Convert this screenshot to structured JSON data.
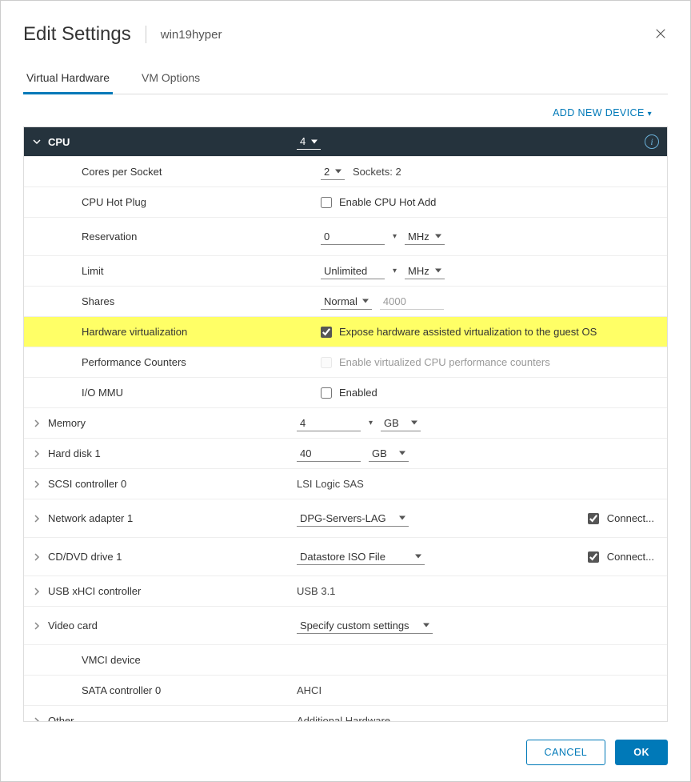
{
  "header": {
    "title": "Edit Settings",
    "subtitle": "win19hyper"
  },
  "tabs": {
    "hardware": "Virtual Hardware",
    "options": "VM Options"
  },
  "add_device": "ADD NEW DEVICE",
  "cpu": {
    "label": "CPU",
    "value": "4",
    "cores_label": "Cores per Socket",
    "cores_value": "2",
    "sockets_text": "Sockets: 2",
    "hotplug_label": "CPU Hot Plug",
    "hotplug_text": "Enable CPU Hot Add",
    "hotplug_checked": false,
    "reservation_label": "Reservation",
    "reservation_value": "0",
    "reservation_unit": "MHz",
    "limit_label": "Limit",
    "limit_value": "Unlimited",
    "limit_unit": "MHz",
    "shares_label": "Shares",
    "shares_level": "Normal",
    "shares_value": "4000",
    "hwvirt_label": "Hardware virtualization",
    "hwvirt_text": "Expose hardware assisted virtualization to the guest OS",
    "hwvirt_checked": true,
    "perf_label": "Performance Counters",
    "perf_text": "Enable virtualized CPU performance counters",
    "perf_checked": false,
    "perf_disabled": true,
    "iommu_label": "I/O MMU",
    "iommu_text": "Enabled",
    "iommu_checked": false
  },
  "memory": {
    "label": "Memory",
    "value": "4",
    "unit": "GB"
  },
  "disk": {
    "label": "Hard disk 1",
    "value": "40",
    "unit": "GB"
  },
  "scsi": {
    "label": "SCSI controller 0",
    "value": "LSI Logic SAS"
  },
  "net": {
    "label": "Network adapter 1",
    "value": "DPG-Servers-LAG",
    "connect": "Connect...",
    "connected": true
  },
  "cd": {
    "label": "CD/DVD drive 1",
    "value": "Datastore ISO File",
    "connect": "Connect...",
    "connected": true
  },
  "usb": {
    "label": "USB xHCI controller",
    "value": "USB 3.1"
  },
  "video": {
    "label": "Video card",
    "value": "Specify custom settings"
  },
  "vmci": {
    "label": "VMCI device"
  },
  "sata": {
    "label": "SATA controller 0",
    "value": "AHCI"
  },
  "other": {
    "label": "Other",
    "value": "Additional Hardware"
  },
  "footer": {
    "cancel": "CANCEL",
    "ok": "OK"
  }
}
